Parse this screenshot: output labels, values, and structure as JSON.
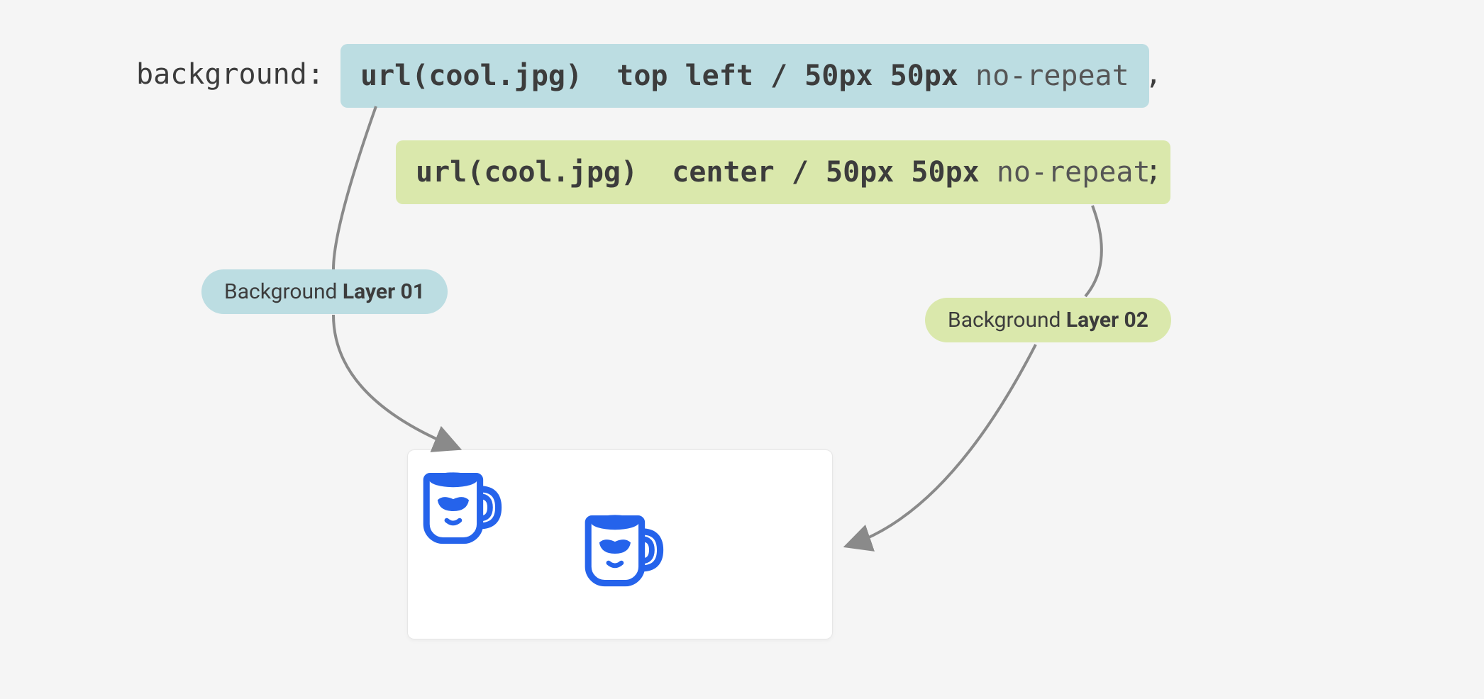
{
  "code": {
    "prop": "background:",
    "layer1": {
      "url": "url(cool.jpg)",
      "pos": "top left / 50px 50px",
      "repeat": "no-repeat",
      "trail": ","
    },
    "layer2": {
      "url": "url(cool.jpg)",
      "pos": "center / 50px 50px",
      "repeat": "no-repeat",
      "trail": ";"
    }
  },
  "pills": {
    "layer1_prefix": "Background ",
    "layer1_bold": "Layer 01",
    "layer2_prefix": "Background ",
    "layer2_bold": "Layer 02"
  },
  "colors": {
    "layer1_bg": "#bcdde2",
    "layer2_bg": "#dae8ac",
    "mug_blue": "#2563eb"
  }
}
